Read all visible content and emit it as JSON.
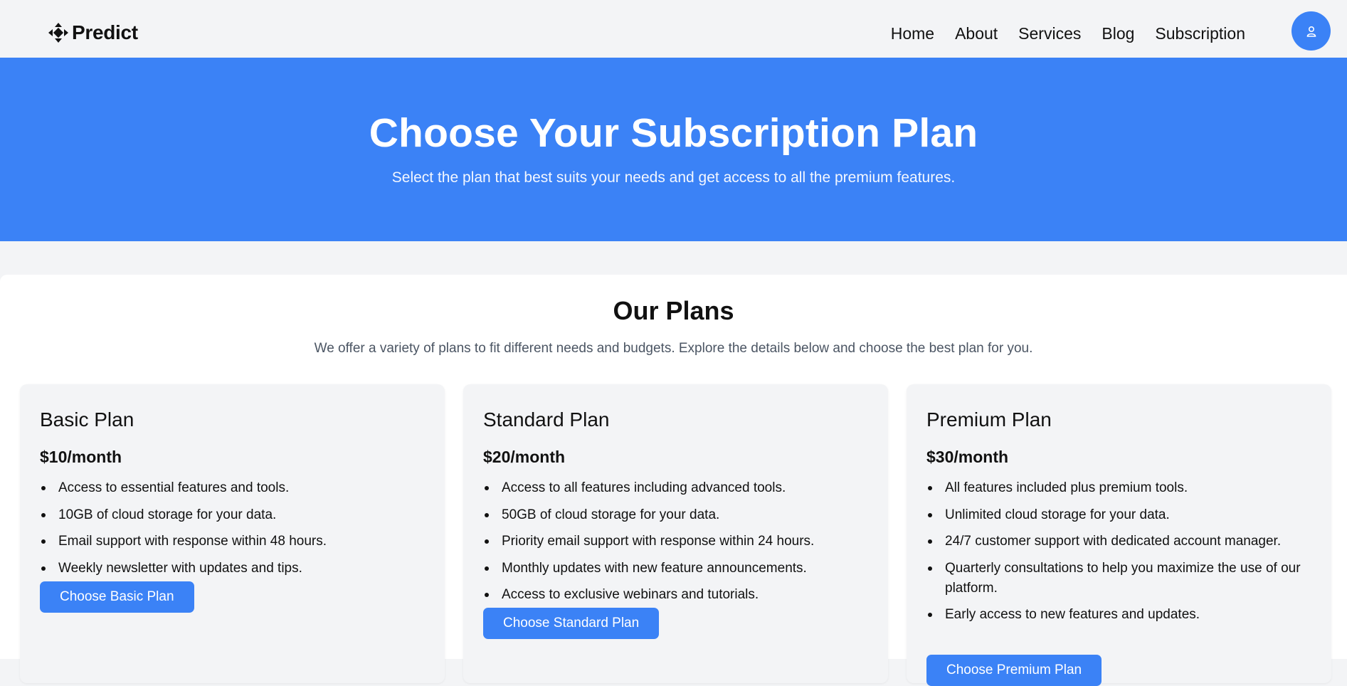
{
  "header": {
    "brand": "Predict",
    "logo_icon": "diamond-arrows-icon",
    "nav": [
      "Home",
      "About",
      "Services",
      "Blog",
      "Subscription"
    ],
    "avatar_icon": "user-icon"
  },
  "hero": {
    "title": "Choose Your Subscription Plan",
    "subtitle": "Select the plan that best suits your needs and get access to all the premium features."
  },
  "plans": {
    "title": "Our Plans",
    "intro": "We offer a variety of plans to fit different needs and budgets. Explore the details below and choose the best plan for you.",
    "cards": [
      {
        "name": "Basic Plan",
        "price": "$10/month",
        "features": [
          "Access to essential features and tools.",
          "10GB of cloud storage for your data.",
          "Email support with response within 48 hours.",
          "Weekly newsletter with updates and tips."
        ],
        "button": "Choose Basic Plan"
      },
      {
        "name": "Standard Plan",
        "price": "$20/month",
        "features": [
          "Access to all features including advanced tools.",
          "50GB of cloud storage for your data.",
          "Priority email support with response within 24 hours.",
          "Monthly updates with new feature announcements.",
          "Access to exclusive webinars and tutorials."
        ],
        "button": "Choose Standard Plan"
      },
      {
        "name": "Premium Plan",
        "price": "$30/month",
        "features": [
          "All features included plus premium tools.",
          "Unlimited cloud storage for your data.",
          "24/7 customer support with dedicated account manager.",
          "Quarterly consultations to help you maximize the use of our platform.",
          "Early access to new features and updates."
        ],
        "button": "Choose Premium Plan"
      }
    ]
  },
  "colors": {
    "accent": "#3b82f6",
    "page_bg": "#f3f4f6",
    "card_bg": "#f3f4f6"
  }
}
